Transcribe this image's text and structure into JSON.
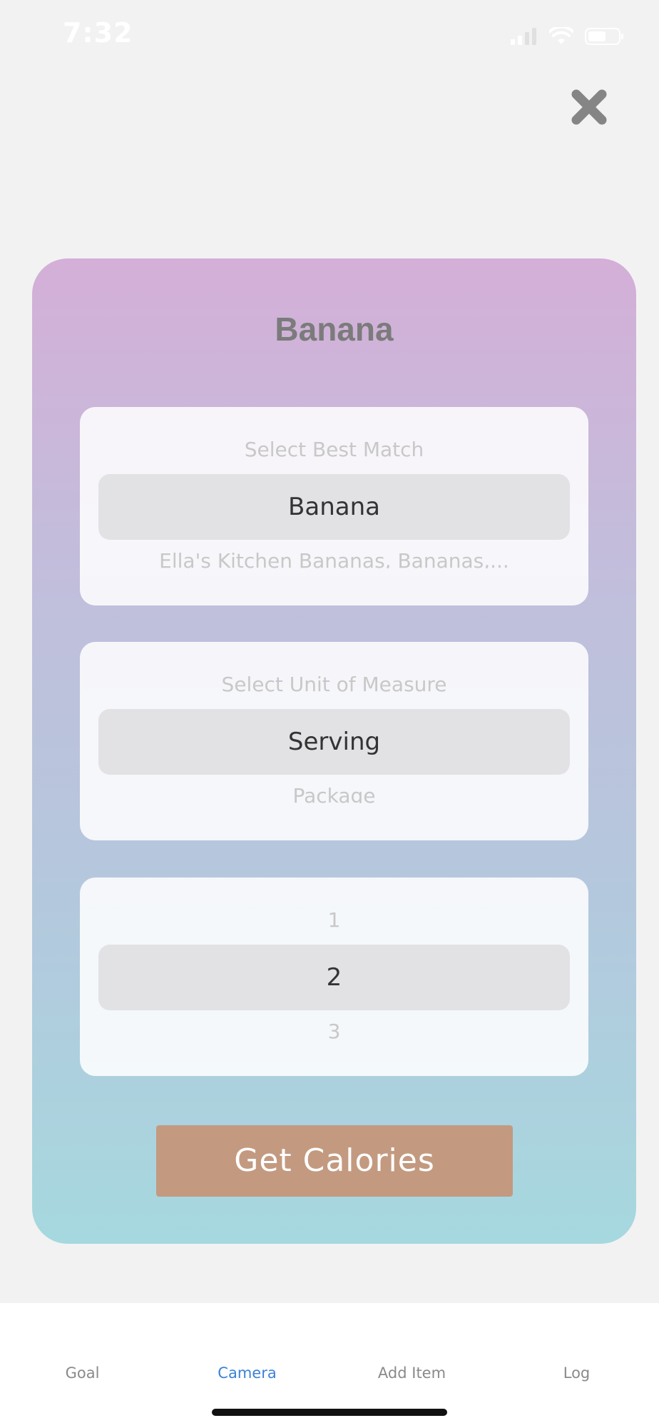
{
  "status_bar": {
    "time": "7:32",
    "icons": [
      "signal-icon",
      "wifi-icon",
      "battery-icon"
    ]
  },
  "close_icon": "close-icon",
  "card": {
    "title": "Banana",
    "best_match": {
      "above": "Select Best Match",
      "selected": "Banana",
      "below": "Ella's Kitchen Bananas, Bananas,..."
    },
    "unit": {
      "above": "Select Unit of Measure",
      "selected": "Serving",
      "below": "Package"
    },
    "quantity": {
      "above": "1",
      "selected": "2",
      "below": "3"
    },
    "cta_label": "Get Calories"
  },
  "tabs": [
    {
      "label": "Goal",
      "active": false
    },
    {
      "label": "Camera",
      "active": true
    },
    {
      "label": "Add Item",
      "active": false
    },
    {
      "label": "Log",
      "active": false
    }
  ],
  "colors": {
    "active_tab": "#3b82d6",
    "cta": "#c39a80",
    "gradient_top": "#d4afd7",
    "gradient_bottom": "#a6d8df"
  }
}
